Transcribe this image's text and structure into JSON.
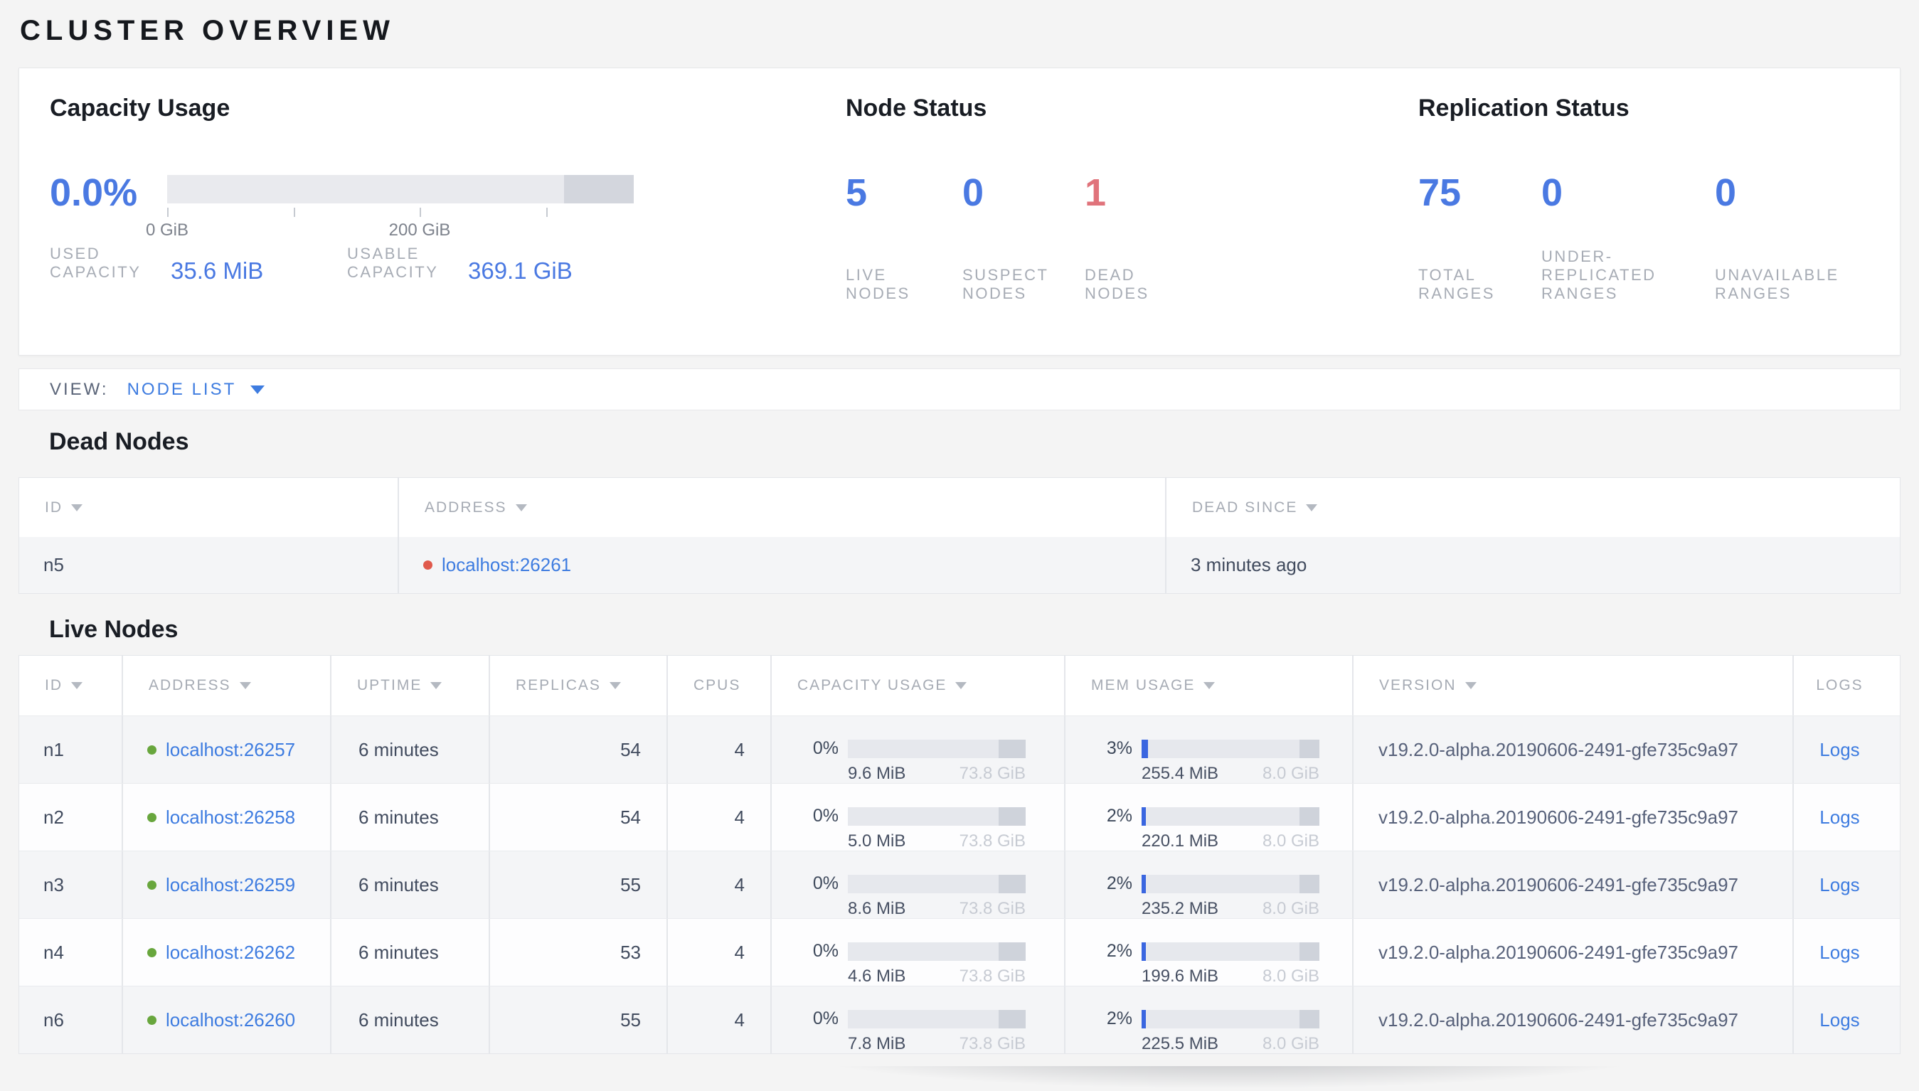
{
  "page": {
    "title": "CLUSTER OVERVIEW"
  },
  "summary": {
    "capacity": {
      "title": "Capacity Usage",
      "percent": "0.0%",
      "tick_labels": [
        "0 GiB",
        "200 GiB"
      ],
      "stats": [
        {
          "label": "USED CAPACITY",
          "value": "35.6 MiB"
        },
        {
          "label": "USABLE CAPACITY",
          "value": "369.1 GiB"
        }
      ]
    },
    "node_status": {
      "title": "Node Status",
      "stats": [
        {
          "value": "5",
          "label": "LIVE NODES",
          "state": "live"
        },
        {
          "value": "0",
          "label": "SUSPECT NODES",
          "state": "suspect"
        },
        {
          "value": "1",
          "label": "DEAD NODES",
          "state": "dead"
        }
      ]
    },
    "replication": {
      "title": "Replication Status",
      "stats": [
        {
          "value": "75",
          "label": "TOTAL RANGES"
        },
        {
          "value": "0",
          "label": "UNDER-REPLICATED RANGES"
        },
        {
          "value": "0",
          "label": "UNAVAILABLE RANGES"
        }
      ]
    }
  },
  "view_bar": {
    "label": "VIEW:",
    "selected": "NODE LIST"
  },
  "dead_nodes": {
    "title": "Dead Nodes",
    "columns": [
      {
        "label": "ID",
        "sortable": true
      },
      {
        "label": "ADDRESS",
        "sortable": true
      },
      {
        "label": "DEAD SINCE",
        "sortable": true
      }
    ],
    "rows": [
      {
        "id": "n5",
        "address": "localhost:26261",
        "dead_since": "3 minutes ago"
      }
    ]
  },
  "live_nodes": {
    "title": "Live Nodes",
    "columns": [
      {
        "label": "ID",
        "sortable": true
      },
      {
        "label": "ADDRESS",
        "sortable": true
      },
      {
        "label": "UPTIME",
        "sortable": true
      },
      {
        "label": "REPLICAS",
        "sortable": true
      },
      {
        "label": "CPUS",
        "sortable": false
      },
      {
        "label": "CAPACITY USAGE",
        "sortable": true
      },
      {
        "label": "MEM USAGE",
        "sortable": true
      },
      {
        "label": "VERSION",
        "sortable": true
      },
      {
        "label": "LOGS",
        "sortable": false
      }
    ],
    "rows": [
      {
        "id": "n1",
        "address": "localhost:26257",
        "uptime": "6 minutes",
        "replicas": "54",
        "cpus": "4",
        "capacity_percent": "0%",
        "capacity_used": "9.6 MiB",
        "capacity_total": "73.8 GiB",
        "mem_percent": "3%",
        "mem_used": "255.4 MiB",
        "mem_total": "8.0 GiB",
        "version": "v19.2.0-alpha.20190606-2491-gfe735c9a97",
        "logs": "Logs"
      },
      {
        "id": "n2",
        "address": "localhost:26258",
        "uptime": "6 minutes",
        "replicas": "54",
        "cpus": "4",
        "capacity_percent": "0%",
        "capacity_used": "5.0 MiB",
        "capacity_total": "73.8 GiB",
        "mem_percent": "2%",
        "mem_used": "220.1 MiB",
        "mem_total": "8.0 GiB",
        "version": "v19.2.0-alpha.20190606-2491-gfe735c9a97",
        "logs": "Logs"
      },
      {
        "id": "n3",
        "address": "localhost:26259",
        "uptime": "6 minutes",
        "replicas": "55",
        "cpus": "4",
        "capacity_percent": "0%",
        "capacity_used": "8.6 MiB",
        "capacity_total": "73.8 GiB",
        "mem_percent": "2%",
        "mem_used": "235.2 MiB",
        "mem_total": "8.0 GiB",
        "version": "v19.2.0-alpha.20190606-2491-gfe735c9a97",
        "logs": "Logs"
      },
      {
        "id": "n4",
        "address": "localhost:26262",
        "uptime": "6 minutes",
        "replicas": "53",
        "cpus": "4",
        "capacity_percent": "0%",
        "capacity_used": "4.6 MiB",
        "capacity_total": "73.8 GiB",
        "mem_percent": "2%",
        "mem_used": "199.6 MiB",
        "mem_total": "8.0 GiB",
        "version": "v19.2.0-alpha.20190606-2491-gfe735c9a97",
        "logs": "Logs"
      },
      {
        "id": "n6",
        "address": "localhost:26260",
        "uptime": "6 minutes",
        "replicas": "55",
        "cpus": "4",
        "capacity_percent": "0%",
        "capacity_used": "7.8 MiB",
        "capacity_total": "73.8 GiB",
        "mem_percent": "2%",
        "mem_used": "225.5 MiB",
        "mem_total": "8.0 GiB",
        "version": "v19.2.0-alpha.20190606-2491-gfe735c9a97",
        "logs": "Logs"
      }
    ]
  },
  "colors": {
    "accent_blue": "#4a79e2",
    "link_blue": "#3e7ce0",
    "dead_red": "#e0737b",
    "live_dot_green": "#68a63d",
    "dead_dot_red": "#e0594c",
    "page_background": "#f4f4f4"
  }
}
